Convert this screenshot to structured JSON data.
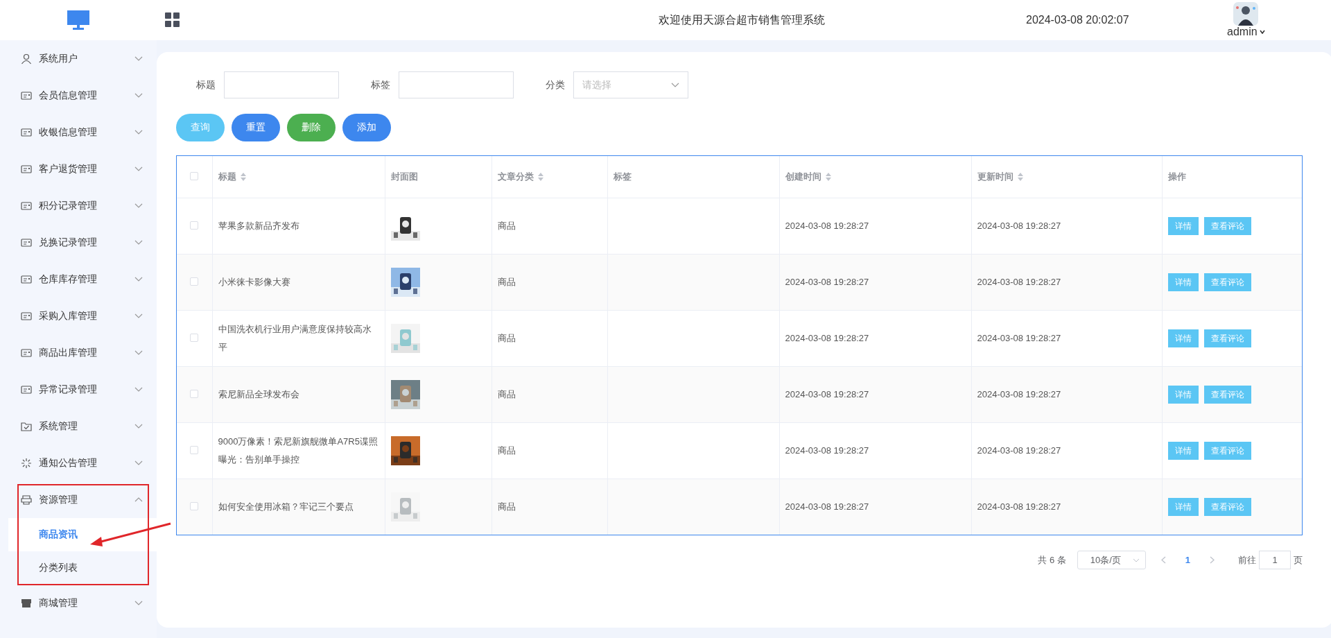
{
  "header": {
    "title": "欢迎使用天源合超市销售管理系统",
    "datetime": "2024-03-08 20:02:07",
    "user": "admin"
  },
  "sidebar": {
    "items": [
      {
        "label": "系统用户",
        "expanded": false
      },
      {
        "label": "会员信息管理",
        "expanded": false
      },
      {
        "label": "收银信息管理",
        "expanded": false
      },
      {
        "label": "客户退货管理",
        "expanded": false
      },
      {
        "label": "积分记录管理",
        "expanded": false
      },
      {
        "label": "兑换记录管理",
        "expanded": false
      },
      {
        "label": "仓库库存管理",
        "expanded": false
      },
      {
        "label": "采购入库管理",
        "expanded": false
      },
      {
        "label": "商品出库管理",
        "expanded": false
      },
      {
        "label": "异常记录管理",
        "expanded": false
      },
      {
        "label": "系统管理",
        "expanded": false
      },
      {
        "label": "通知公告管理",
        "expanded": false
      },
      {
        "label": "资源管理",
        "expanded": true,
        "children": [
          {
            "label": "商品资讯",
            "selected": true
          },
          {
            "label": "分类列表",
            "selected": false
          }
        ]
      },
      {
        "label": "商城管理",
        "expanded": false
      }
    ]
  },
  "filters": [
    {
      "label": "标题",
      "kind": "text"
    },
    {
      "label": "标签",
      "kind": "text"
    },
    {
      "label": "分类",
      "kind": "select",
      "placeholder": "请选择"
    }
  ],
  "buttons": [
    {
      "label": "查询",
      "color": "#5bc6f4"
    },
    {
      "label": "重置",
      "color": "#3d87ee"
    },
    {
      "label": "删除",
      "color": "#4caf50"
    },
    {
      "label": "添加",
      "color": "#3d87ee"
    }
  ],
  "table": {
    "all_checked": false,
    "columns": [
      {
        "label": "标题",
        "sortable": true
      },
      {
        "label": "封面图",
        "sortable": false
      },
      {
        "label": "文章分类",
        "sortable": true
      },
      {
        "label": "标签",
        "sortable": false
      },
      {
        "label": "创建时间",
        "sortable": true
      },
      {
        "label": "更新时间",
        "sortable": true
      },
      {
        "label": "操作",
        "sortable": false
      }
    ],
    "rows": [
      {
        "checked": false,
        "title": "苹果多款新品齐发布",
        "cover": {
          "kind": "picture"
        },
        "category": "商品",
        "created": "2024-03-08 19:28:27",
        "updated": "2024-03-08 19:28:27",
        "actions": [
          "详情",
          "查看评论"
        ]
      },
      {
        "checked": false,
        "title": "小米徕卡影像大赛",
        "cover": {
          "kind": "picture"
        },
        "category": "商品",
        "created": "2024-03-08 19:28:27",
        "updated": "2024-03-08 19:28:27",
        "actions": [
          "详情",
          "查看评论"
        ]
      },
      {
        "checked": false,
        "title": "中国洗衣机行业用户满意度保持较高水平",
        "cover": {
          "kind": "picture"
        },
        "category": "商品",
        "created": "2024-03-08 19:28:27",
        "updated": "2024-03-08 19:28:27",
        "actions": [
          "详情",
          "查看评论"
        ]
      },
      {
        "checked": false,
        "title": "索尼新品全球发布会",
        "cover": {
          "kind": "picture"
        },
        "category": "商品",
        "created": "2024-03-08 19:28:27",
        "updated": "2024-03-08 19:28:27",
        "actions": [
          "详情",
          "查看评论"
        ]
      },
      {
        "checked": false,
        "title": "9000万像素！索尼新旗舰微单A7R5谍照曝光：告别单手操控",
        "cover": {
          "kind": "picture"
        },
        "category": "商品",
        "created": "2024-03-08 19:28:27",
        "updated": "2024-03-08 19:28:27",
        "actions": [
          "详情",
          "查看评论"
        ]
      },
      {
        "checked": false,
        "title": "如何安全使用冰箱？牢记三个要点",
        "cover": {
          "kind": "picture"
        },
        "category": "商品",
        "created": "2024-03-08 19:28:27",
        "updated": "2024-03-08 19:28:27",
        "actions": [
          "详情",
          "查看评论"
        ]
      }
    ]
  },
  "pagination": {
    "total": "共 6 条",
    "page_size": "10条/页",
    "pages": [
      {
        "label": "1",
        "selected": true
      }
    ],
    "goto_label": "前往",
    "goto_value": "1",
    "goto_suffix": "页"
  }
}
